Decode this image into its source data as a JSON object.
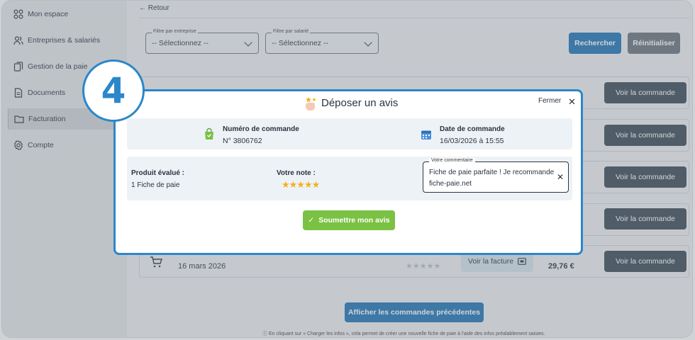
{
  "sidebar": {
    "items": [
      {
        "label": "Mon espace",
        "icon": "grid-icon"
      },
      {
        "label": "Entreprises & salariés",
        "icon": "users-icon"
      },
      {
        "label": "Gestion de la paie",
        "icon": "documents-icon"
      },
      {
        "label": "Documents",
        "icon": "document-icon"
      },
      {
        "label": "Facturation",
        "icon": "folder-icon",
        "active": true
      },
      {
        "label": "Compte",
        "icon": "gear-icon"
      }
    ]
  },
  "header": {
    "back_label": "Retour"
  },
  "filters": {
    "entreprise": {
      "label": "Filtre par entreprise",
      "value": "-- Sélectionnez --"
    },
    "salarie": {
      "label": "Filtre par salarié",
      "value": "-- Sélectionnez --"
    },
    "search_label": "Rechercher",
    "reset_label": "Réinitialiser"
  },
  "orders": {
    "voir_commande_label": "Voir la commande",
    "last_row": {
      "date": "16 mars 2026",
      "stars": "★★★★★",
      "invoice_label": "Voir la facture",
      "total": "29,76 €"
    }
  },
  "footer": {
    "prev_label": "Afficher les commandes précédentes",
    "note": "En cliquant sur « Charger les infos », cela permet de créer une nouvelle fiche de paie à l'aide des infos préalablement saisies."
  },
  "step_badge": "4",
  "modal": {
    "title": "Déposer un avis",
    "close_label": "Fermer",
    "close_x": "✕",
    "order_number_label": "Numéro de commande",
    "order_number": "N° 3806762",
    "order_date_label": "Date de commande",
    "order_date": "16/03/2026 à 15:55",
    "product_label": "Produit évalué :",
    "product_value": "1 Fiche de paie",
    "rating_label": "Votre note :",
    "rating": 5,
    "rating_stars": "★★★★★",
    "comment_label": "Votre commentaire",
    "comment_text": "Fiche de paie parfaite ! Je recommande fiche-paie.net",
    "submit_label": "Soumettre mon avis",
    "submit_check": "✓"
  },
  "colors": {
    "primary": "#1e73b5",
    "accent": "#2b87c9",
    "success": "#7bc143",
    "dark_button": "#3b4a56",
    "star": "#f3b21a"
  }
}
